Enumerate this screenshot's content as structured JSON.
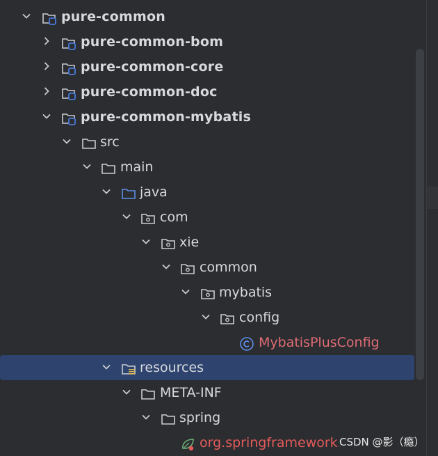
{
  "tree": {
    "items": [
      {
        "label": "pure-common",
        "chevron": "expanded",
        "icon": "module-folder-icon",
        "bold": true
      },
      {
        "label": "pure-common-bom",
        "chevron": "collapsed",
        "icon": "module-folder-icon",
        "bold": true
      },
      {
        "label": "pure-common-core",
        "chevron": "collapsed",
        "icon": "module-folder-icon",
        "bold": true
      },
      {
        "label": "pure-common-doc",
        "chevron": "collapsed",
        "icon": "module-folder-icon",
        "bold": true
      },
      {
        "label": "pure-common-mybatis",
        "chevron": "expanded",
        "icon": "module-folder-icon",
        "bold": true
      },
      {
        "label": "src",
        "chevron": "expanded",
        "icon": "folder-icon"
      },
      {
        "label": "main",
        "chevron": "expanded",
        "icon": "folder-icon"
      },
      {
        "label": "java",
        "chevron": "expanded",
        "icon": "source-folder-icon"
      },
      {
        "label": "com",
        "chevron": "expanded",
        "icon": "package-icon"
      },
      {
        "label": "xie",
        "chevron": "expanded",
        "icon": "package-icon"
      },
      {
        "label": "common",
        "chevron": "expanded",
        "icon": "package-icon"
      },
      {
        "label": "mybatis",
        "chevron": "expanded",
        "icon": "package-icon"
      },
      {
        "label": "config",
        "chevron": "expanded",
        "icon": "package-icon"
      },
      {
        "label": "MybatisPlusConfig",
        "chevron": "none",
        "icon": "class-icon"
      },
      {
        "label": "resources",
        "chevron": "expanded",
        "icon": "resources-folder-icon",
        "selected": true
      },
      {
        "label": "META-INF",
        "chevron": "expanded",
        "icon": "folder-icon"
      },
      {
        "label": "spring",
        "chevron": "expanded",
        "icon": "folder-icon"
      },
      {
        "label": "org.springframework.boot.autoconfigure.AutoConfiguration.imports",
        "chevron": "none",
        "icon": "spring-file-icon"
      }
    ]
  },
  "watermark": "CSDN @影（瘾）",
  "colors": {
    "background": "#2b2d30",
    "selection": "#2e436e",
    "text": "#d7d9dd",
    "class_name": "#e06c75",
    "module_badge": "#4a7bdc"
  }
}
